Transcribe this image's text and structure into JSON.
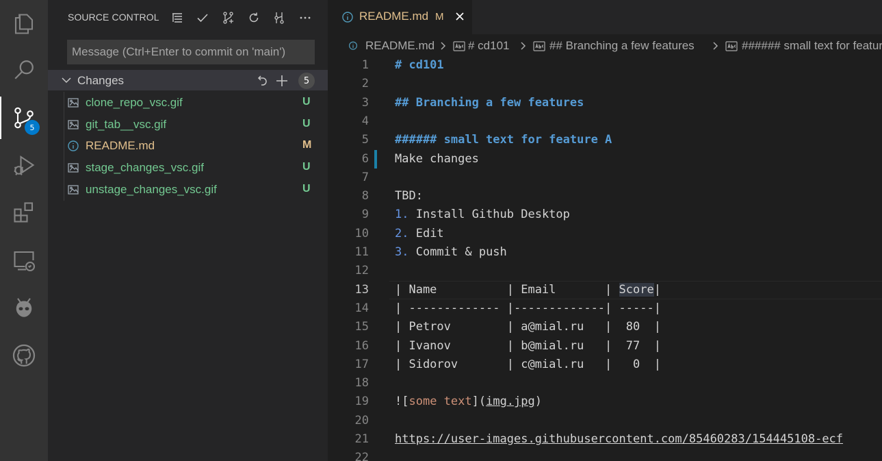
{
  "activity_bar": {
    "items": [
      {
        "name": "explorer",
        "icon": "files-icon"
      },
      {
        "name": "search",
        "icon": "search-icon"
      },
      {
        "name": "source-control",
        "icon": "source-control-icon",
        "badge": "5",
        "active": true
      },
      {
        "name": "run-debug",
        "icon": "debug-icon"
      },
      {
        "name": "extensions",
        "icon": "extensions-icon"
      },
      {
        "name": "remote-explorer",
        "icon": "remote-explorer-icon"
      },
      {
        "name": "platformio",
        "icon": "alien-icon"
      },
      {
        "name": "github",
        "icon": "github-icon"
      }
    ]
  },
  "sidebar": {
    "title": "SOURCE CONTROL",
    "header_actions": [
      "view-as-tree-icon",
      "commit-check-icon",
      "pull-request-icon",
      "refresh-icon",
      "branch-graph-icon",
      "more-actions-icon"
    ],
    "commit_placeholder": "Message (Ctrl+Enter to commit on 'main')",
    "changes": {
      "label": "Changes",
      "count": "5",
      "files": [
        {
          "name": "clone_repo_vsc.gif",
          "status": "U",
          "icon": "image-file-icon"
        },
        {
          "name": "git_tab__vsc.gif",
          "status": "U",
          "icon": "image-file-icon"
        },
        {
          "name": "README.md",
          "status": "M",
          "icon": "info-icon"
        },
        {
          "name": "stage_changes_vsc.gif",
          "status": "U",
          "icon": "image-file-icon"
        },
        {
          "name": "unstage_changes_vsc.gif",
          "status": "U",
          "icon": "image-file-icon"
        }
      ]
    }
  },
  "editor": {
    "tab": {
      "title": "README.md",
      "modified": "M"
    },
    "breadcrumb": [
      "README.md",
      "# cd101",
      "## Branching a few features",
      "###### small text for feature A"
    ],
    "current_line": "13",
    "lines": [
      {
        "n": "1",
        "text": "# cd101"
      },
      {
        "n": "2",
        "text": ""
      },
      {
        "n": "3",
        "text": "## Branching a few features"
      },
      {
        "n": "4",
        "text": ""
      },
      {
        "n": "5",
        "text": "###### small text for feature A"
      },
      {
        "n": "6",
        "text": "Make changes"
      },
      {
        "n": "7",
        "text": ""
      },
      {
        "n": "8",
        "text": "TBD:"
      },
      {
        "n": "9",
        "num": "1.",
        "text": " Install Github Desktop"
      },
      {
        "n": "10",
        "num": "2.",
        "text": " Edit"
      },
      {
        "n": "11",
        "num": "3.",
        "text": " Commit & push"
      },
      {
        "n": "12",
        "text": ""
      },
      {
        "n": "13",
        "text": "| Name          | Email       | ",
        "tail": "Score",
        "end": "|"
      },
      {
        "n": "14",
        "text": "| ------------- |-------------| -----|"
      },
      {
        "n": "15",
        "text": "| Petrov        | a@mial.ru   |  80  |"
      },
      {
        "n": "16",
        "text": "| Ivanov        | b@mial.ru   |  77  |"
      },
      {
        "n": "17",
        "text": "| Sidorov       | c@mial.ru   |   0  |"
      },
      {
        "n": "18",
        "text": ""
      },
      {
        "n": "19",
        "pre": "![",
        "alt": "some text",
        "mid": "](",
        "src": "img.jpg",
        "post": ")"
      },
      {
        "n": "20",
        "text": ""
      },
      {
        "n": "21",
        "url": "https://user-images.githubusercontent.com/85460283/154445108-ecf"
      },
      {
        "n": "22",
        "text": ""
      }
    ]
  },
  "colors": {
    "accent": "#007acc",
    "untracked": "#73c991",
    "modified": "#e2c08d",
    "heading": "#569cd6",
    "link_text": "#ce9178"
  }
}
